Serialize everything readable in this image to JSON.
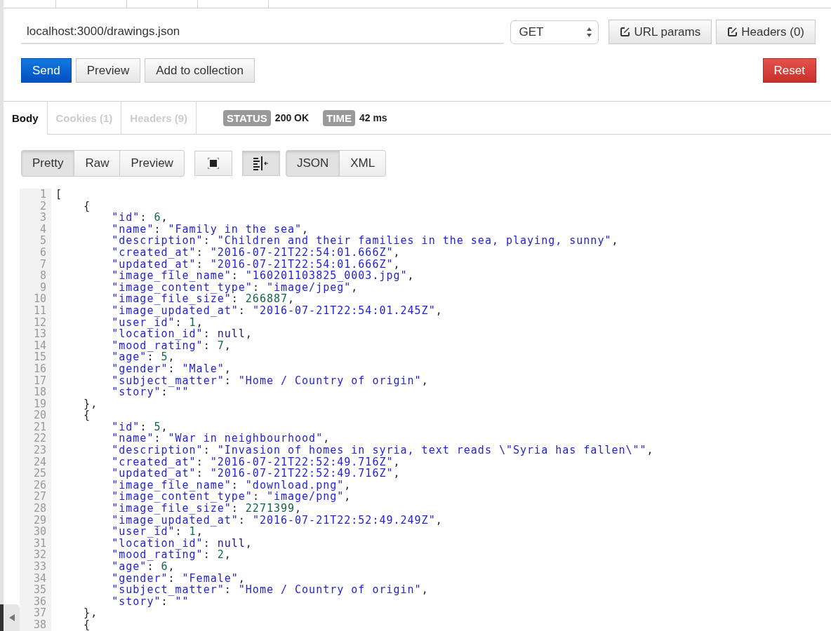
{
  "request": {
    "url": "localhost:3000/drawings.json",
    "method": "GET"
  },
  "header_buttons": [
    {
      "label": "URL params"
    },
    {
      "label": "Headers (0)"
    }
  ],
  "actions": [
    {
      "label": "Send",
      "kind": "primary"
    },
    {
      "label": "Preview",
      "kind": "default"
    },
    {
      "label": "Add to collection",
      "kind": "default"
    }
  ],
  "reset_button": {
    "label": "Reset"
  },
  "response_tabs": [
    {
      "label": "Body",
      "selected": true
    },
    {
      "label": "Cookies (1)",
      "selected": false
    },
    {
      "label": "Headers (9)",
      "selected": false
    }
  ],
  "status": {
    "badge": "STATUS",
    "value": "200 OK"
  },
  "time": {
    "badge": "TIME",
    "value": "42 ms"
  },
  "view_modes": [
    {
      "label": "Pretty",
      "selected": true
    },
    {
      "label": "Raw",
      "selected": false
    },
    {
      "label": "Preview",
      "selected": false
    }
  ],
  "tools": [
    {
      "kind": "fullscreen",
      "on": false
    },
    {
      "kind": "wrap",
      "on": true
    }
  ],
  "formats": [
    {
      "label": "JSON",
      "selected": true
    },
    {
      "label": "XML",
      "selected": false
    }
  ],
  "code": {
    "lines": [
      {
        "number": "1",
        "text": "["
      },
      {
        "number": "2",
        "text": "    {"
      },
      {
        "number": "3",
        "text": "        \"id\": 6,"
      },
      {
        "number": "4",
        "text": "        \"name\": \"Family in the sea\","
      },
      {
        "number": "5",
        "text": "        \"description\": \"Children and their families in the sea, playing, sunny\","
      },
      {
        "number": "6",
        "text": "        \"created_at\": \"2016-07-21T22:54:01.666Z\","
      },
      {
        "number": "7",
        "text": "        \"updated_at\": \"2016-07-21T22:54:01.666Z\","
      },
      {
        "number": "8",
        "text": "        \"image_file_name\": \"160201103825_0003.jpg\","
      },
      {
        "number": "9",
        "text": "        \"image_content_type\": \"image/jpeg\","
      },
      {
        "number": "10",
        "text": "        \"image_file_size\": 266887,"
      },
      {
        "number": "11",
        "text": "        \"image_updated_at\": \"2016-07-21T22:54:01.245Z\","
      },
      {
        "number": "12",
        "text": "        \"user_id\": 1,"
      },
      {
        "number": "13",
        "text": "        \"location_id\": null,"
      },
      {
        "number": "14",
        "text": "        \"mood_rating\": 7,"
      },
      {
        "number": "15",
        "text": "        \"age\": 5,"
      },
      {
        "number": "16",
        "text": "        \"gender\": \"Male\","
      },
      {
        "number": "17",
        "text": "        \"subject_matter\": \"Home / Country of origin\","
      },
      {
        "number": "18",
        "text": "        \"story\": \"\""
      },
      {
        "number": "19",
        "text": "    },"
      },
      {
        "number": "20",
        "text": "    {"
      },
      {
        "number": "21",
        "text": "        \"id\": 5,"
      },
      {
        "number": "22",
        "text": "        \"name\": \"War in neighbourhood\","
      },
      {
        "number": "23",
        "text": "        \"description\": \"Invasion of homes in syria, text reads \\\"Syria has fallen\\\"\","
      },
      {
        "number": "24",
        "text": "        \"created_at\": \"2016-07-21T22:52:49.716Z\","
      },
      {
        "number": "25",
        "text": "        \"updated_at\": \"2016-07-21T22:52:49.716Z\","
      },
      {
        "number": "26",
        "text": "        \"image_file_name\": \"download.png\","
      },
      {
        "number": "27",
        "text": "        \"image_content_type\": \"image/png\","
      },
      {
        "number": "28",
        "text": "        \"image_file_size\": 2271399,"
      },
      {
        "number": "29",
        "text": "        \"image_updated_at\": \"2016-07-21T22:52:49.249Z\","
      },
      {
        "number": "30",
        "text": "        \"user_id\": 1,"
      },
      {
        "number": "31",
        "text": "        \"location_id\": null,"
      },
      {
        "number": "32",
        "text": "        \"mood_rating\": 2,"
      },
      {
        "number": "33",
        "text": "        \"age\": 6,"
      },
      {
        "number": "34",
        "text": "        \"gender\": \"Female\","
      },
      {
        "number": "35",
        "text": "        \"subject_matter\": \"Home / Country of origin\","
      },
      {
        "number": "36",
        "text": "        \"story\": \"\""
      },
      {
        "number": "37",
        "text": "    },"
      },
      {
        "number": "38",
        "text": "    {"
      }
    ]
  }
}
